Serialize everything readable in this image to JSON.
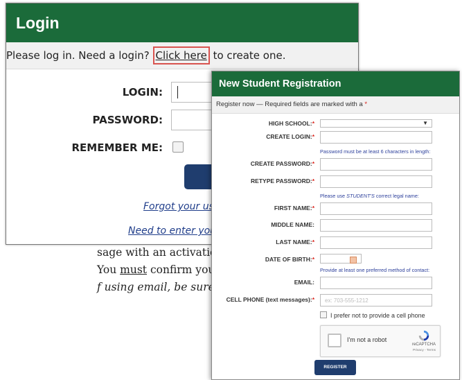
{
  "document": {
    "line1": "sage with an activation",
    "line2_pre": "You ",
    "line2_u": "must",
    "line2_post": " confirm your",
    "line3": "f using email, be sure to"
  },
  "login": {
    "title": "Login",
    "message_pre": "Please log in. Need a login? ",
    "message_link": "Click here",
    "message_post": " to create one.",
    "login_label": "LOGIN:",
    "password_label": "PASSWORD:",
    "remember_label": "REMEMBER ME:",
    "forgot_link": "Forgot your use",
    "need_link": "Need to enter your"
  },
  "registration": {
    "title": "New Student Registration",
    "subtitle": "Register now — Required fields are marked with a ",
    "required_mark": "*",
    "fields": {
      "high_school": "HIGH SCHOOL:",
      "create_login": "CREATE LOGIN:",
      "create_password": "CREATE PASSWORD:",
      "retype_password": "RETYPE PASSWORD:",
      "first_name": "FIRST NAME:",
      "middle_name": "MIDDLE NAME:",
      "last_name": "LAST NAME:",
      "date_of_birth": "DATE OF BIRTH:",
      "email": "EMAIL:",
      "cell_phone": "CELL PHONE (text messages):"
    },
    "hints": {
      "password": "Password must be at least 6 characters in length:",
      "legal_pre": "Please use ",
      "legal_em": "STUDENT'S",
      "legal_post": " correct legal name:",
      "contact": "Provide at least one preferred method of contact:"
    },
    "phone_placeholder": "ex: 703-555-1212",
    "no_phone_label": "I prefer not to provide a cell phone",
    "captcha_label": "I'm not a robot",
    "captcha_brand": "reCAPTCHA",
    "captcha_terms": "Privacy - Terms",
    "register_button": "REGISTER"
  },
  "colors": {
    "header_green": "#1b6b3a",
    "button_navy": "#1f3d6e",
    "required_red": "#d9241c",
    "hint_blue": "#2c3f9b"
  }
}
